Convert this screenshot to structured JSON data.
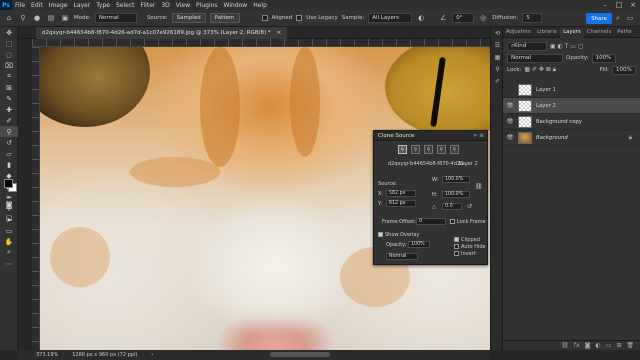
{
  "menu": {
    "logo": "Ps",
    "items": [
      "File",
      "Edit",
      "Image",
      "Layer",
      "Type",
      "Select",
      "Filter",
      "3D",
      "View",
      "Plugins",
      "Window",
      "Help"
    ]
  },
  "options": {
    "mode_label": "Mode:",
    "mode_value": "Normal",
    "source_label": "Source:",
    "source_sampled": "Sampled",
    "source_pattern": "Pattern",
    "aligned_label": "Aligned",
    "legacy_label": "Use Legacy",
    "sample_label": "Sample:",
    "sample_value": "All Layers",
    "angle_value": "0°",
    "diffusion_label": "Diffusion:",
    "diffusion_value": "5",
    "share_label": "Share"
  },
  "document": {
    "tab_title": "d2qxyqr-b44654b8-f870-4d26-ad7d-a1c07e926189.jpg @ 373% (Layer 2, RGB/8) *",
    "close_glyph": "×"
  },
  "clone_source": {
    "title": "Clone Source",
    "file_label": "d2qxyqr-b44654b8-f870-4d26...",
    "layer_label": "Layer 2",
    "offset_label": "Source:",
    "x_label": "X:",
    "x_value": "582 px",
    "y_label": "Y:",
    "y_value": "612 px",
    "w_label": "W:",
    "w_value": "100.0%",
    "h_label": "H:",
    "h_value": "100.0%",
    "angle_value": "0.0",
    "frame_offset_label": "Frame Offset:",
    "frame_offset_value": "0",
    "lock_frame_label": "Lock Frame",
    "show_overlay_label": "Show Overlay",
    "opacity_label": "Opacity:",
    "opacity_value": "100%",
    "clipped_label": "Clipped",
    "auto_hide_label": "Auto Hide",
    "invert_label": "Invert",
    "blend_value": "Normal"
  },
  "layers_panel": {
    "tabs": [
      "Adjustmn",
      "Librarie",
      "Layers",
      "Channels",
      "Paths"
    ],
    "active_tab": "Layers",
    "kind_label": "Kind",
    "blend_mode": "Normal",
    "opacity_label": "Opacity:",
    "opacity_value": "100%",
    "lock_label": "Lock:",
    "fill_label": "Fill:",
    "fill_value": "100%",
    "layers": [
      {
        "name": "Layer 1",
        "visible": false,
        "selected": false,
        "thumb": "empty"
      },
      {
        "name": "Layer 2",
        "visible": true,
        "selected": true,
        "thumb": "empty"
      },
      {
        "name": "Background copy",
        "visible": true,
        "selected": false,
        "thumb": "empty"
      },
      {
        "name": "Background",
        "visible": true,
        "selected": false,
        "thumb": "cat",
        "locked": true
      }
    ]
  },
  "status": {
    "zoom": "373.19%",
    "dimensions": "1280 px x 960 px (72 ppi)"
  }
}
